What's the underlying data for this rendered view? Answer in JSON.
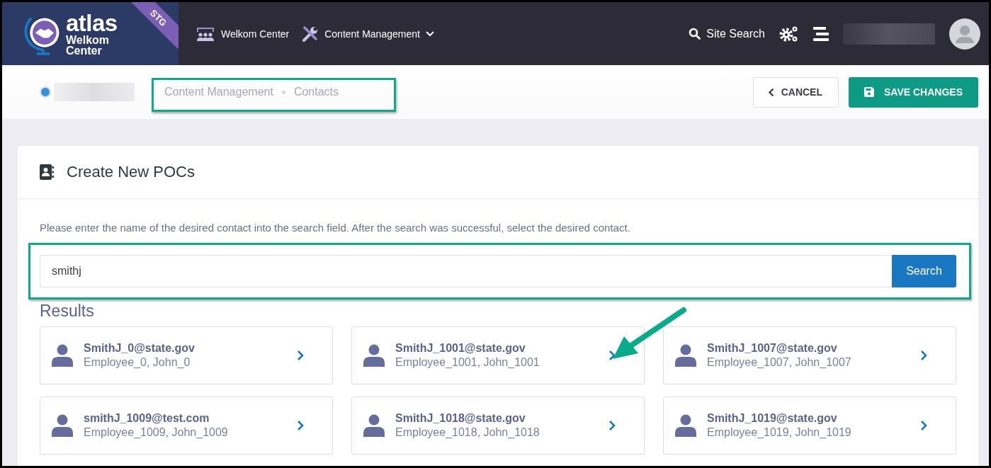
{
  "header": {
    "logo": {
      "name": "atlas",
      "subtitle": "Welkom Center",
      "badge": "STG"
    },
    "nav": [
      {
        "label": "Welkom Center",
        "kind": "link"
      },
      {
        "label": "Content Management",
        "kind": "dropdown"
      }
    ],
    "site_search": "Site Search"
  },
  "breadcrumbs": [
    "Content Management",
    "Contacts"
  ],
  "actions": {
    "cancel": "CANCEL",
    "save": "SAVE CHANGES"
  },
  "panel": {
    "title": "Create New POCs",
    "instructions": "Please enter the name of the desired contact into the search field. After the search was successful, select the desired contact.",
    "search": {
      "value": "smithj",
      "button": "Search"
    },
    "results_heading": "Results",
    "results": [
      {
        "email": "SmithJ_0@state.gov",
        "name": "Employee_0, John_0"
      },
      {
        "email": "SmithJ_1001@state.gov",
        "name": "Employee_1001, John_1001"
      },
      {
        "email": "SmithJ_1007@state.gov",
        "name": "Employee_1007, John_1007"
      },
      {
        "email": "smithJ_1009@test.com",
        "name": "Employee_1009, John_1009"
      },
      {
        "email": "SmithJ_1018@state.gov",
        "name": "Employee_1018, John_1018"
      },
      {
        "email": "SmithJ_1019@state.gov",
        "name": "Employee_1019, John_1019"
      }
    ]
  }
}
